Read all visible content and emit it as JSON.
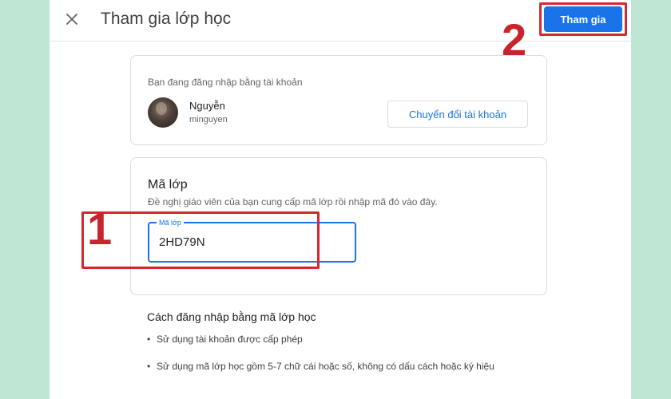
{
  "dialog": {
    "title": "Tham gia lớp học",
    "close_icon": "close-icon",
    "join_label": "Tham gia"
  },
  "account": {
    "caption": "Bạn đang đăng nhập bằng tài khoản",
    "name": "Nguyễn",
    "username": "minguyen",
    "switch_label": "Chuyển đổi tài khoản"
  },
  "class_code": {
    "heading": "Mã lớp",
    "description": "Đề nghị giáo viên của bạn cung cấp mã lớp rồi nhập mã đó vào đây.",
    "field_label": "Mã lớp",
    "value": "2HD79N"
  },
  "instructions": {
    "heading": "Cách đăng nhập bằng mã lớp học",
    "items": [
      "Sử dụng tài khoản được cấp phép",
      "Sử dụng mã lớp học gồm 5-7 chữ cái hoặc số, không có dấu cách hoặc ký hiệu"
    ]
  },
  "annotations": {
    "step_1": "1",
    "step_2": "2",
    "highlight_color": "#d7262e"
  },
  "colors": {
    "accent": "#1a73e8",
    "background": "#bfe6d4"
  }
}
